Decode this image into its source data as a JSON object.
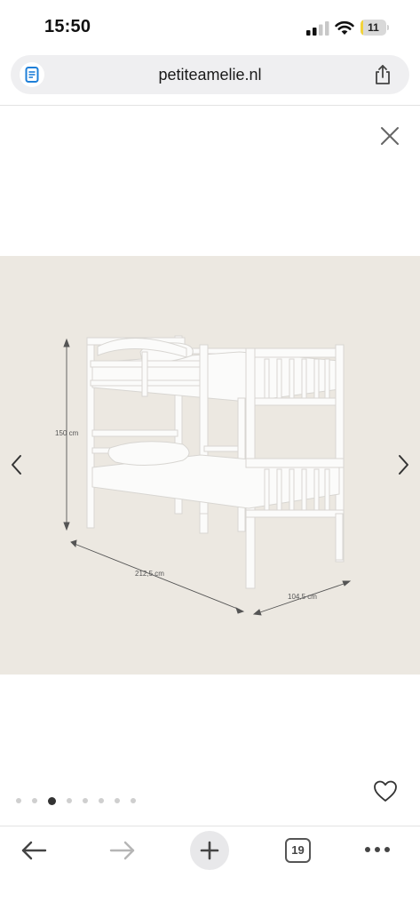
{
  "status_bar": {
    "time": "15:50",
    "battery_level": "11",
    "battery_fraction": 0.11,
    "battery_color": "#f2d33b"
  },
  "browser": {
    "url": "petiteamelie.nl",
    "left_icon": "reader-icon",
    "right_icon": "share-icon"
  },
  "gallery": {
    "close_icon": "close-icon",
    "prev_icon": "chevron-left-icon",
    "next_icon": "chevron-right-icon",
    "favorite_icon": "heart-icon",
    "background_color": "#ece8e1",
    "image": {
      "subject": "white bunk bed",
      "height_label": "150 cm",
      "length_label": "212,5 cm",
      "width_label": "104,5 cm"
    },
    "pagination": {
      "total": 8,
      "active_index": 2
    }
  },
  "toolbar": {
    "back_icon": "arrow-left-icon",
    "forward_icon": "arrow-right-icon",
    "new_tab_icon": "plus-icon",
    "tab_count": "19",
    "more_icon": "more-dots-icon"
  }
}
